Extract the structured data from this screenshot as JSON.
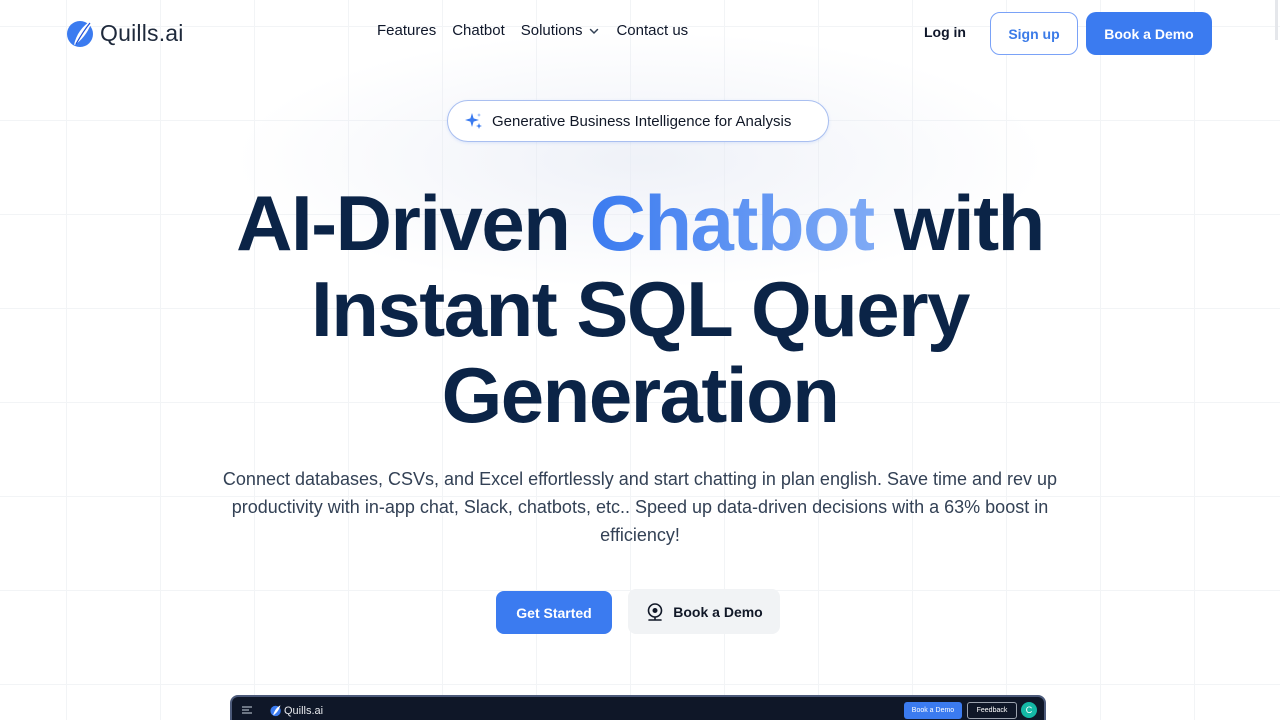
{
  "brand": {
    "name": "Quills.ai",
    "accent": "#3b7bf0",
    "heading_color": "#0b2447"
  },
  "nav": {
    "links": [
      {
        "label": "Features"
      },
      {
        "label": "Chatbot"
      },
      {
        "label": "Solutions",
        "icon": "chevron-down-icon"
      },
      {
        "label": "Contact us"
      }
    ],
    "login_label": "Log in",
    "signup_label": "Sign up",
    "demo_label": "Book a Demo"
  },
  "hero": {
    "badge": {
      "icon": "sparkle-icon",
      "text": "Generative Business Intelligence for Analysis"
    },
    "headline": {
      "part1": "AI-Driven ",
      "accent": "Chatbot",
      "part2": " with Instant SQL Query Generation"
    },
    "subtitle": "Connect databases, CSVs, and Excel effortlessly and start chatting in plan english. Save time and rev up productivity with in-app chat, Slack, chatbots, etc.. Speed up data-driven decisions with a 63% boost in efficiency!",
    "cta_primary": "Get Started",
    "cta_secondary": {
      "icon": "webcam-icon",
      "label": "Book a Demo"
    }
  },
  "preview": {
    "app_name": "Quills.ai",
    "demo_label": "Book a Demo",
    "feedback_label": "Feedback",
    "avatar_initial": "C"
  }
}
